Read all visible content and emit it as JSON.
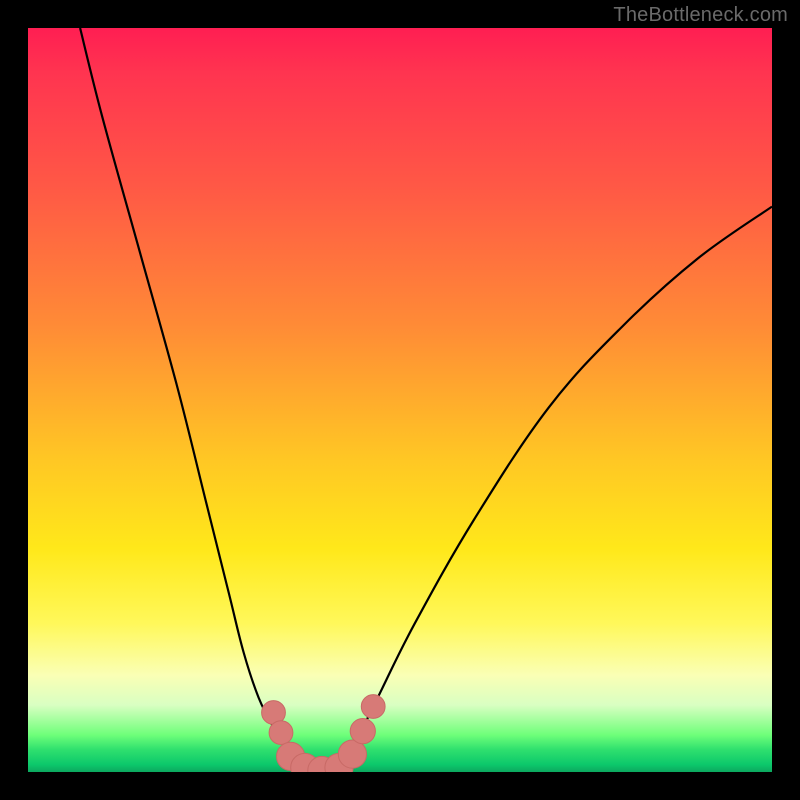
{
  "watermark": "TheBottleneck.com",
  "colors": {
    "frame": "#000000",
    "gradient_top": "#ff1e52",
    "gradient_mid": "#ffe81a",
    "gradient_bottom": "#0cc86b",
    "curve": "#000000",
    "bead": "#d77a77"
  },
  "chart_data": {
    "type": "line",
    "title": "",
    "xlabel": "",
    "ylabel": "",
    "xlim": [
      0,
      100
    ],
    "ylim": [
      0,
      100
    ],
    "grid": false,
    "legend": false,
    "note": "Two V-shaped bottleneck curves; values estimated from pixel positions within a 744x744 plot area. y=0 is bottom (green), y=100 is top (red).",
    "series": [
      {
        "name": "left-curve",
        "x": [
          7,
          10,
          15,
          20,
          24,
          27,
          29,
          31,
          33,
          35,
          36.5,
          38,
          40
        ],
        "y": [
          100,
          88,
          70,
          52,
          36,
          24,
          16,
          10,
          6,
          3,
          1,
          0.3,
          0
        ]
      },
      {
        "name": "right-curve",
        "x": [
          40,
          42,
          44,
          47,
          52,
          60,
          70,
          80,
          90,
          100
        ],
        "y": [
          0,
          1,
          4,
          10,
          20,
          34,
          49,
          60,
          69,
          76
        ]
      }
    ],
    "markers": [
      {
        "name": "bead-left-upper",
        "x": 33.0,
        "y": 8.0,
        "r": 1.6
      },
      {
        "name": "bead-left-mid",
        "x": 34.0,
        "y": 5.3,
        "r": 1.6
      },
      {
        "name": "bead-left-lower",
        "x": 35.3,
        "y": 2.1,
        "r": 1.9
      },
      {
        "name": "bead-bottom-1",
        "x": 37.2,
        "y": 0.6,
        "r": 1.9
      },
      {
        "name": "bead-bottom-2",
        "x": 39.5,
        "y": 0.2,
        "r": 1.9
      },
      {
        "name": "bead-bottom-3",
        "x": 41.8,
        "y": 0.6,
        "r": 1.9
      },
      {
        "name": "bead-right-lower",
        "x": 43.6,
        "y": 2.4,
        "r": 1.9
      },
      {
        "name": "bead-right-mid",
        "x": 45.0,
        "y": 5.5,
        "r": 1.7
      },
      {
        "name": "bead-right-upper",
        "x": 46.4,
        "y": 8.8,
        "r": 1.6
      }
    ]
  }
}
